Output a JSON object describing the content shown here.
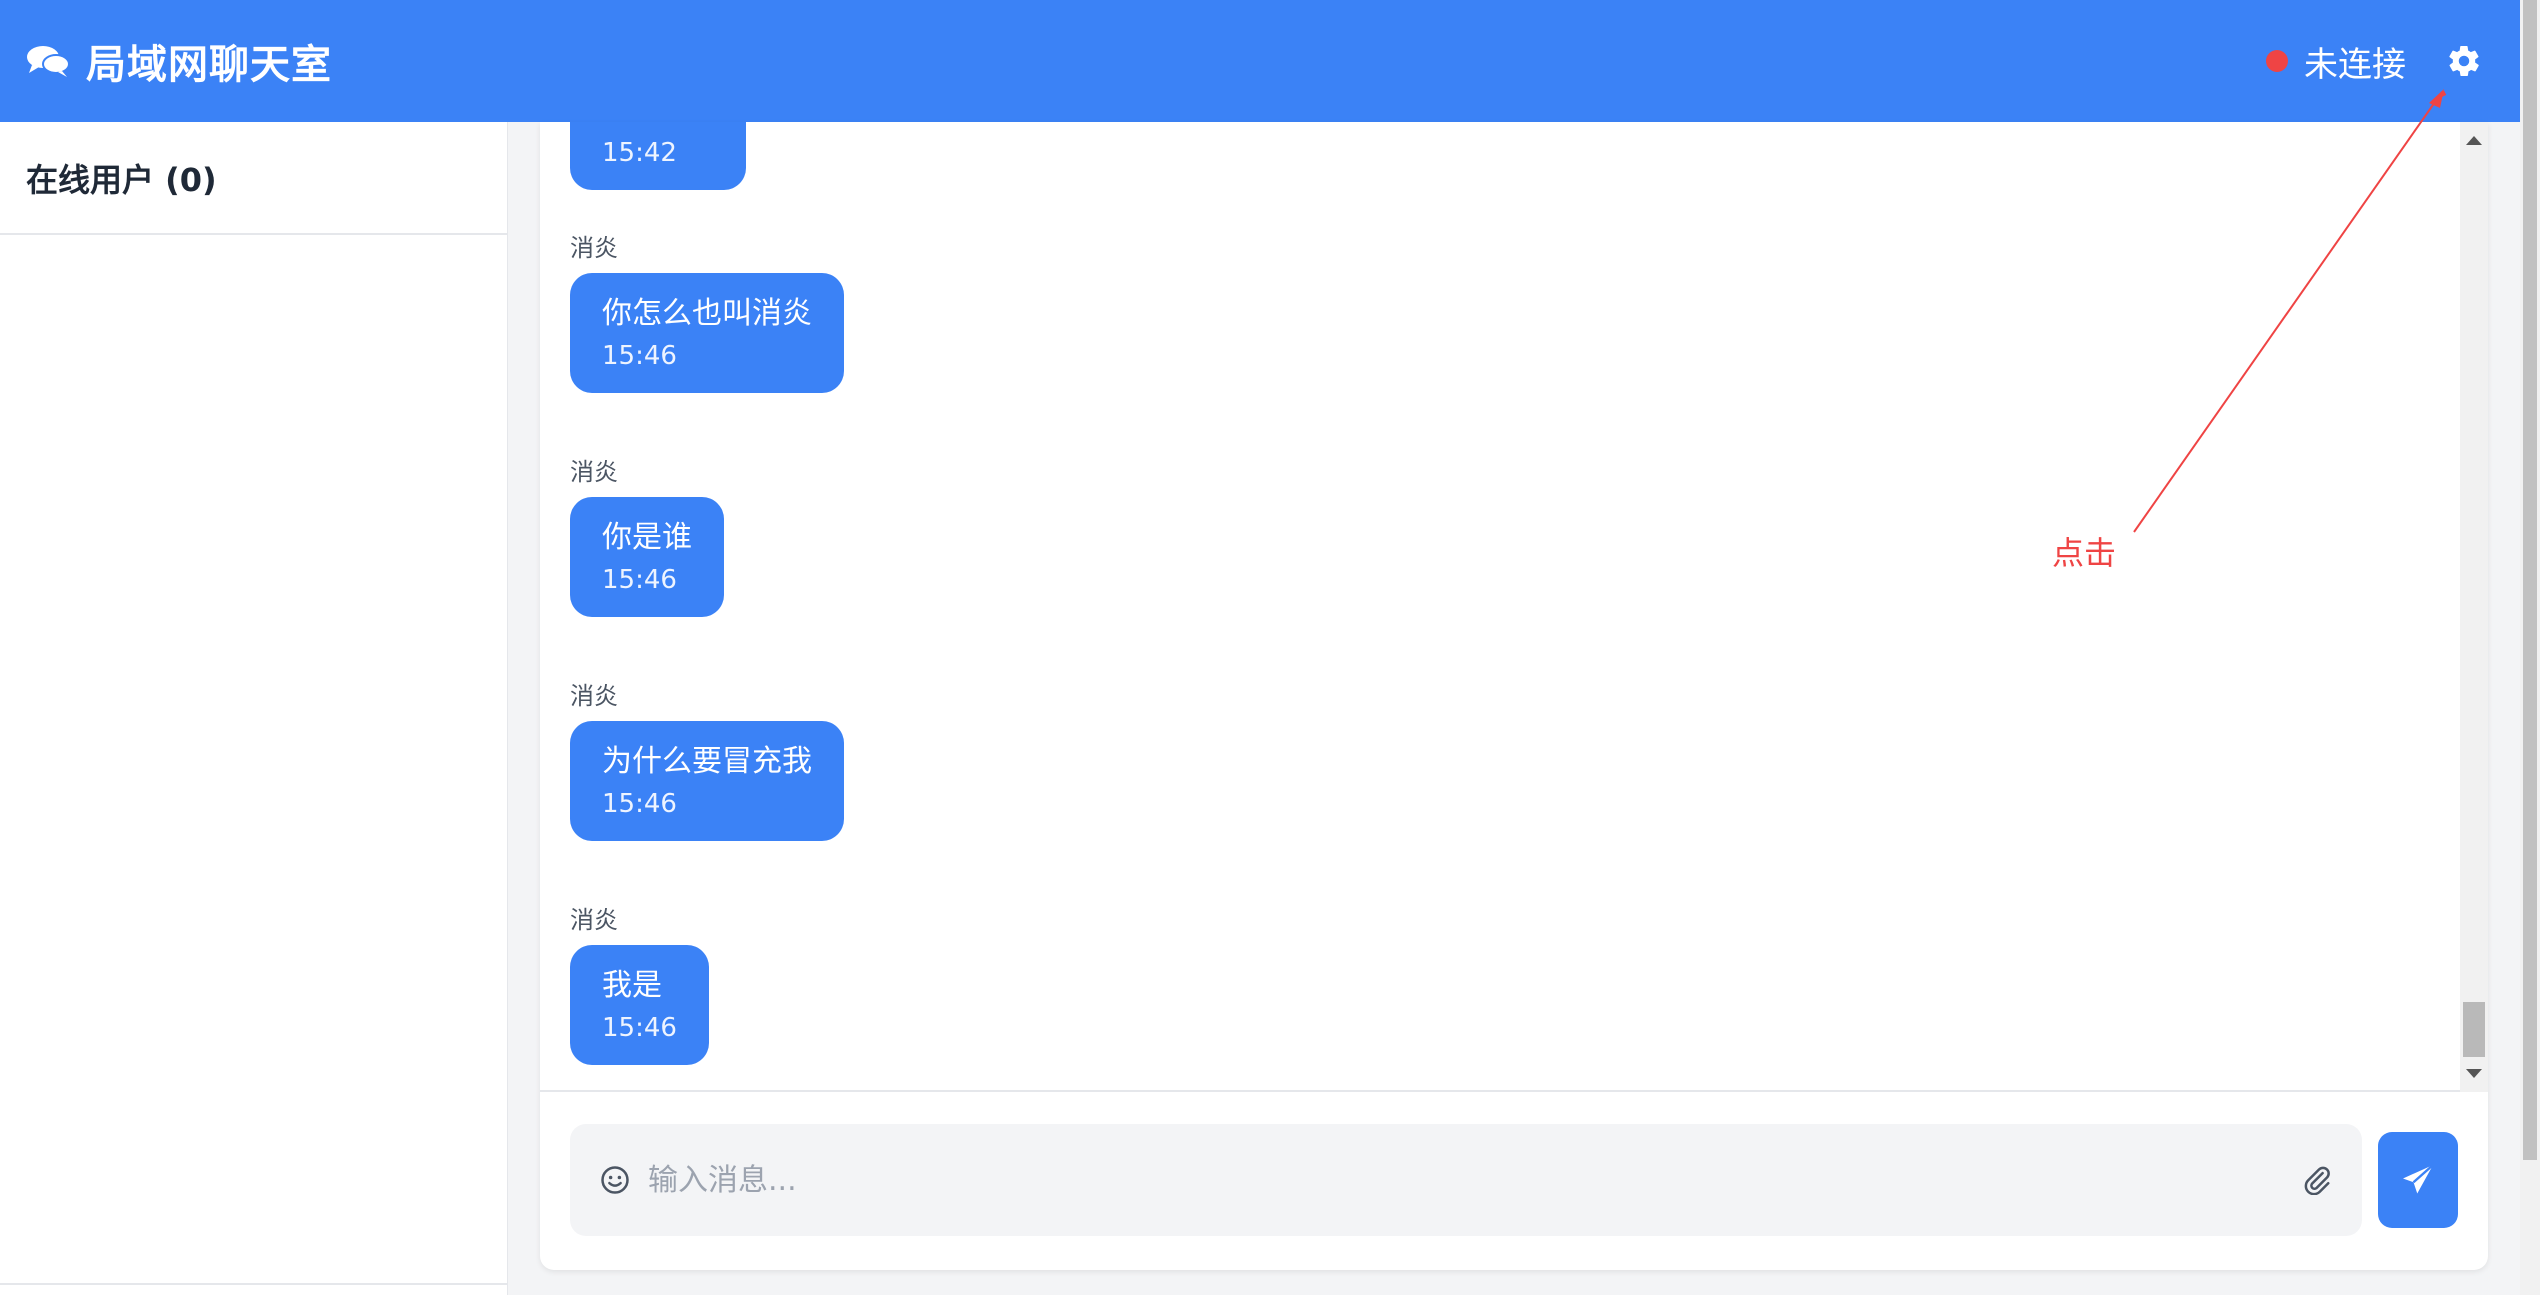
{
  "header": {
    "title": "局域网聊天室",
    "status_text": "未连接",
    "colors": {
      "primary": "#3b82f6",
      "status": "#ef4444"
    }
  },
  "sidebar": {
    "title": "在线用户 (0)"
  },
  "messages": [
    {
      "sender": "",
      "text": "",
      "time": "15:42"
    },
    {
      "sender": "消炎",
      "text": "你怎么也叫消炎",
      "time": "15:46"
    },
    {
      "sender": "消炎",
      "text": "你是谁",
      "time": "15:46"
    },
    {
      "sender": "消炎",
      "text": "为什么要冒充我",
      "time": "15:46"
    },
    {
      "sender": "消炎",
      "text": "我是",
      "time": "15:46"
    }
  ],
  "composer": {
    "placeholder": "输入消息...",
    "emoji_icon": "smile-icon",
    "attach_icon": "paperclip-icon",
    "send_icon": "paper-plane-icon"
  },
  "annotation": {
    "text": "点击"
  }
}
